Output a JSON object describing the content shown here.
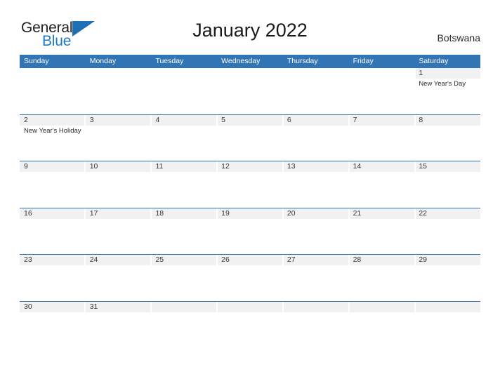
{
  "brand": {
    "name_top": "General",
    "name_bottom": "Blue",
    "triangle_color": "#1f6fb5",
    "blue_color": "#1f7ac0"
  },
  "header": {
    "title": "January 2022",
    "country": "Botswana",
    "accent_color": "#3175b5",
    "band_color": "#f1f1f1"
  },
  "weekdays": [
    "Sunday",
    "Monday",
    "Tuesday",
    "Wednesday",
    "Thursday",
    "Friday",
    "Saturday"
  ],
  "weeks": [
    [
      {
        "day": "",
        "event": "",
        "filled": false
      },
      {
        "day": "",
        "event": "",
        "filled": false
      },
      {
        "day": "",
        "event": "",
        "filled": false
      },
      {
        "day": "",
        "event": "",
        "filled": false
      },
      {
        "day": "",
        "event": "",
        "filled": false
      },
      {
        "day": "",
        "event": "",
        "filled": false
      },
      {
        "day": "1",
        "event": "New Year's Day",
        "filled": true
      }
    ],
    [
      {
        "day": "2",
        "event": "New Year's Holiday",
        "filled": true
      },
      {
        "day": "3",
        "event": "",
        "filled": true
      },
      {
        "day": "4",
        "event": "",
        "filled": true
      },
      {
        "day": "5",
        "event": "",
        "filled": true
      },
      {
        "day": "6",
        "event": "",
        "filled": true
      },
      {
        "day": "7",
        "event": "",
        "filled": true
      },
      {
        "day": "8",
        "event": "",
        "filled": true
      }
    ],
    [
      {
        "day": "9",
        "event": "",
        "filled": true
      },
      {
        "day": "10",
        "event": "",
        "filled": true
      },
      {
        "day": "11",
        "event": "",
        "filled": true
      },
      {
        "day": "12",
        "event": "",
        "filled": true
      },
      {
        "day": "13",
        "event": "",
        "filled": true
      },
      {
        "day": "14",
        "event": "",
        "filled": true
      },
      {
        "day": "15",
        "event": "",
        "filled": true
      }
    ],
    [
      {
        "day": "16",
        "event": "",
        "filled": true
      },
      {
        "day": "17",
        "event": "",
        "filled": true
      },
      {
        "day": "18",
        "event": "",
        "filled": true
      },
      {
        "day": "19",
        "event": "",
        "filled": true
      },
      {
        "day": "20",
        "event": "",
        "filled": true
      },
      {
        "day": "21",
        "event": "",
        "filled": true
      },
      {
        "day": "22",
        "event": "",
        "filled": true
      }
    ],
    [
      {
        "day": "23",
        "event": "",
        "filled": true
      },
      {
        "day": "24",
        "event": "",
        "filled": true
      },
      {
        "day": "25",
        "event": "",
        "filled": true
      },
      {
        "day": "26",
        "event": "",
        "filled": true
      },
      {
        "day": "27",
        "event": "",
        "filled": true
      },
      {
        "day": "28",
        "event": "",
        "filled": true
      },
      {
        "day": "29",
        "event": "",
        "filled": true
      }
    ],
    [
      {
        "day": "30",
        "event": "",
        "filled": true
      },
      {
        "day": "31",
        "event": "",
        "filled": true
      },
      {
        "day": "",
        "event": "",
        "filled": true
      },
      {
        "day": "",
        "event": "",
        "filled": true
      },
      {
        "day": "",
        "event": "",
        "filled": true
      },
      {
        "day": "",
        "event": "",
        "filled": true
      },
      {
        "day": "",
        "event": "",
        "filled": true
      }
    ]
  ]
}
